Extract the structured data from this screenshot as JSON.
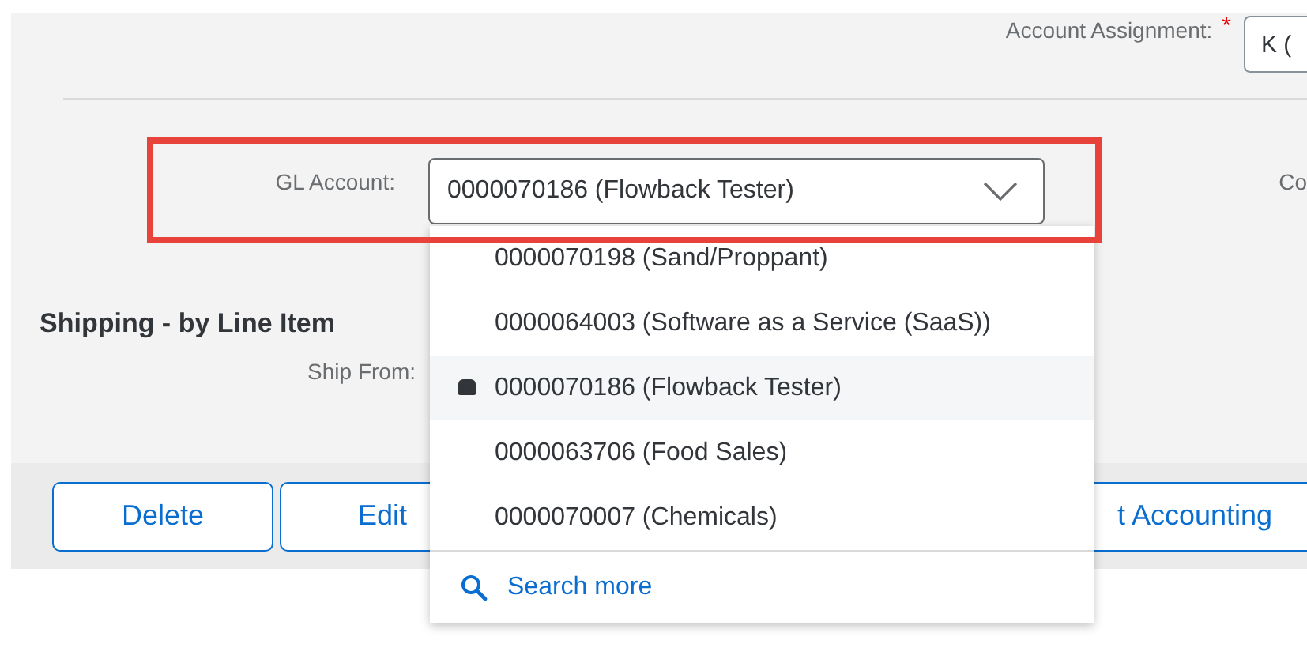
{
  "account_assignment": {
    "label": "Account Assignment:",
    "required_mark": "*",
    "value": "K ("
  },
  "gl_account": {
    "label": "GL Account:",
    "value": "0000070186 (Flowback Tester)",
    "expanded": true
  },
  "column_3_label": "Co",
  "section_title": "Shipping - by Line Item",
  "ship_from": {
    "label": "Ship From:"
  },
  "toolbar": {
    "buttons": [
      "Delete",
      "Edit",
      "t Accounting"
    ]
  },
  "dropdown": {
    "items": [
      {
        "label": "0000070198 (Sand/Proppant)",
        "selected": false
      },
      {
        "label": "0000064003 (Software as a Service (SaaS))",
        "selected": false
      },
      {
        "label": "0000070186 (Flowback Tester)",
        "selected": true
      },
      {
        "label": "0000063706 (Food Sales)",
        "selected": false
      },
      {
        "label": "0000070007 (Chemicals)",
        "selected": false
      }
    ],
    "search_more": "Search more"
  }
}
